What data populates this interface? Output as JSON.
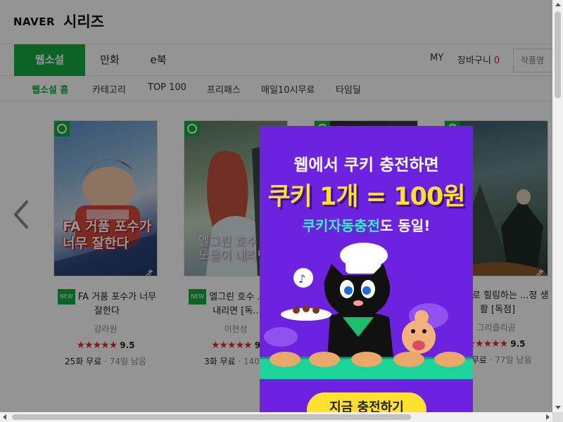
{
  "header": {
    "naver_logo": "NAVER",
    "series_logo": "시리즈"
  },
  "main_tabs": [
    {
      "label": "웹소설",
      "active": true
    },
    {
      "label": "만화",
      "active": false
    },
    {
      "label": "e북",
      "active": false
    }
  ],
  "utility": {
    "my": "MY",
    "cart_label": "장바구니",
    "cart_count": "0",
    "search_placeholder": "작품명"
  },
  "sub_tabs": [
    {
      "label": "웹소설 홈",
      "active": true
    },
    {
      "label": "카테고리",
      "active": false
    },
    {
      "label": "TOP 100",
      "active": false
    },
    {
      "label": "프리패스",
      "active": false
    },
    {
      "label": "매일10시무료",
      "active": false
    },
    {
      "label": "타임딜",
      "active": false
    }
  ],
  "books": [
    {
      "title": "FA 거품 포수가 너무 잘한다",
      "new_badge": "NEW",
      "author": "강라원",
      "stars": "★★★★★",
      "rating": "9.5",
      "free": "25화 무료",
      "ago": "· 74일 남음",
      "cover_text": "FA 거품 포수가\n너무 잘한다",
      "edition": "SERIES EDITION"
    },
    {
      "title": "엘그린 호수 ... 을이 내리면 [독...",
      "new_badge": "NEW",
      "author": "이현성",
      "stars": "★★★★★",
      "rating": "9",
      "free": "3화 무료",
      "ago": "· 140일",
      "cover_text": "엘그린 호수\n노을이 내리면",
      "edition": ""
    },
    {
      "title": "",
      "new_badge": "",
      "author": "",
      "stars": "",
      "rating": "",
      "free": "",
      "ago": "",
      "cover_text": "",
      "edition": ""
    },
    {
      "title": "...핑으로 힐링하는 ...정 생활 [독점]",
      "new_badge": "",
      "author": "그리즐리곰",
      "stars": "★★★★★",
      "rating": "9.5",
      "free": "... 무료",
      "ago": "· 77일 남음",
      "cover_text": "",
      "edition": "SERIES EDITION"
    }
  ],
  "popup": {
    "line1": "웹에서 쿠키 충전하면",
    "line2": "쿠키 1개 = 100원",
    "line3_highlight": "쿠키자동충전",
    "line3_rest": "도 동일!",
    "cta": "지금 충전하기"
  },
  "colors": {
    "brand_green": "#13ab3f",
    "popup_purple": "#6d22e0",
    "popup_yellow": "#ffe02e",
    "popup_mint": "#35f0c8",
    "rating_red": "#e22b2b"
  }
}
